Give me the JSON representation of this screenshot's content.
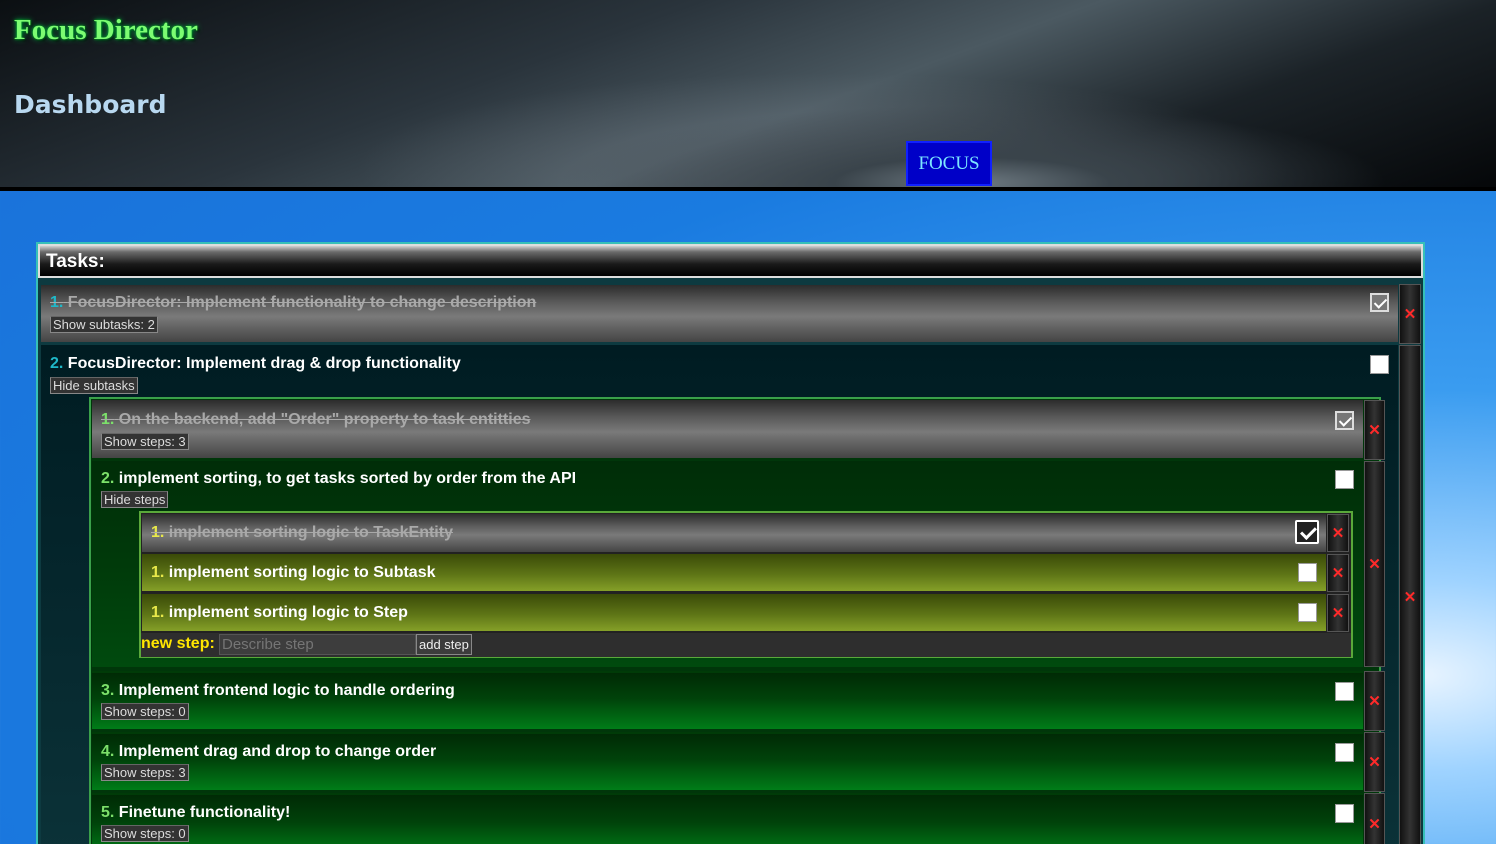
{
  "header": {
    "app_title": "Focus Director",
    "page_title": "Dashboard",
    "focus_button": "FOCUS"
  },
  "tasks_panel": {
    "title": "Tasks:",
    "tasks": [
      {
        "number": "1.",
        "title": "FocusDirector: Implement functionality to change description",
        "done": true,
        "toggle_label": "Show subtasks: 2"
      },
      {
        "number": "2.",
        "title": "FocusDirector: Implement drag & drop functionality",
        "done": false,
        "toggle_label": "Hide subtasks",
        "subtasks": [
          {
            "number": "1.",
            "title": "On the backend, add \"Order\" property to task entitties",
            "done": true,
            "toggle_label": "Show steps: 3"
          },
          {
            "number": "2.",
            "title": "implement sorting, to get tasks sorted by order from the API",
            "done": false,
            "toggle_label": "Hide steps",
            "steps": [
              {
                "number": "1.",
                "title": "implement sorting logic to TaskEntity",
                "done": true
              },
              {
                "number": "1.",
                "title": "implement sorting logic to Subtask",
                "done": false
              },
              {
                "number": "1.",
                "title": "implement sorting logic to Step",
                "done": false
              }
            ],
            "new_step": {
              "label": "new step:",
              "placeholder": "Describe step",
              "button": "add step"
            }
          },
          {
            "number": "3.",
            "title": "Implement frontend logic to handle ordering",
            "done": false,
            "toggle_label": "Show steps: 0"
          },
          {
            "number": "4.",
            "title": "Implement drag and drop to change order",
            "done": false,
            "toggle_label": "Show steps: 3"
          },
          {
            "number": "5.",
            "title": "Finetune functionality!",
            "done": false,
            "toggle_label": "Show steps: 0"
          }
        ]
      }
    ]
  },
  "icons": {
    "delete": "close-x-icon",
    "check": "checkmark-icon"
  },
  "colors": {
    "app_title": "#7cfc72",
    "focus_button_bg": "#0000c8",
    "delete_x": "#ff2a2a",
    "new_step_label": "#ffe600"
  }
}
